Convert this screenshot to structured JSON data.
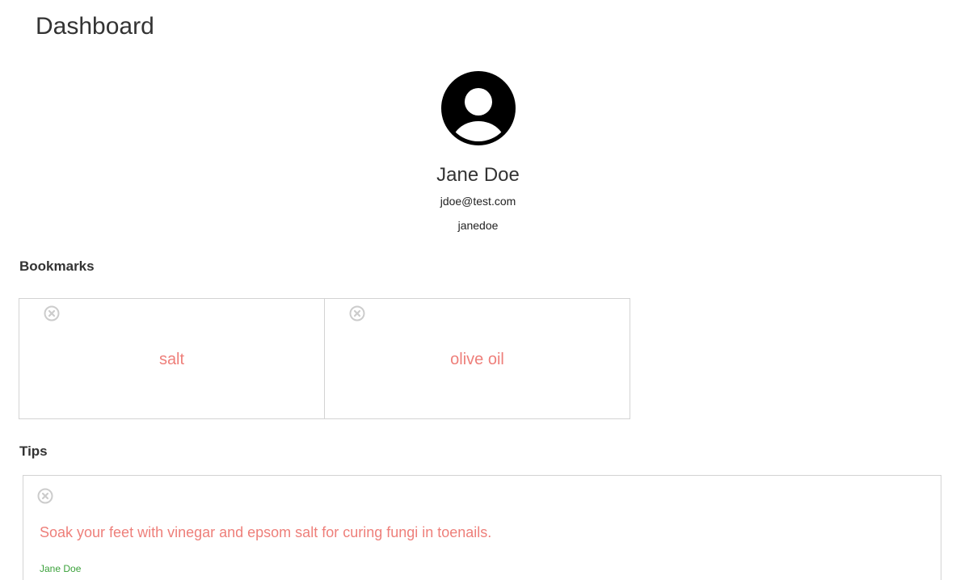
{
  "page": {
    "title": "Dashboard"
  },
  "profile": {
    "avatar_icon": "user-circle-icon",
    "name": "Jane Doe",
    "email": "jdoe@test.com",
    "username": "janedoe"
  },
  "bookmarks": {
    "heading": "Bookmarks",
    "remove_icon": "close-circle-icon",
    "items": [
      {
        "label": "salt"
      },
      {
        "label": "olive oil"
      }
    ]
  },
  "tips": {
    "heading": "Tips",
    "remove_icon": "close-circle-icon",
    "items": [
      {
        "text": "Soak your feet with vinegar and epsom salt for curing fungi in toenails.",
        "author": "Jane Doe"
      }
    ]
  },
  "colors": {
    "accent_text": "#ee7f7a",
    "author_text": "#3aa13a",
    "border": "#d3d3d3",
    "icon_gray": "#cccccc"
  }
}
